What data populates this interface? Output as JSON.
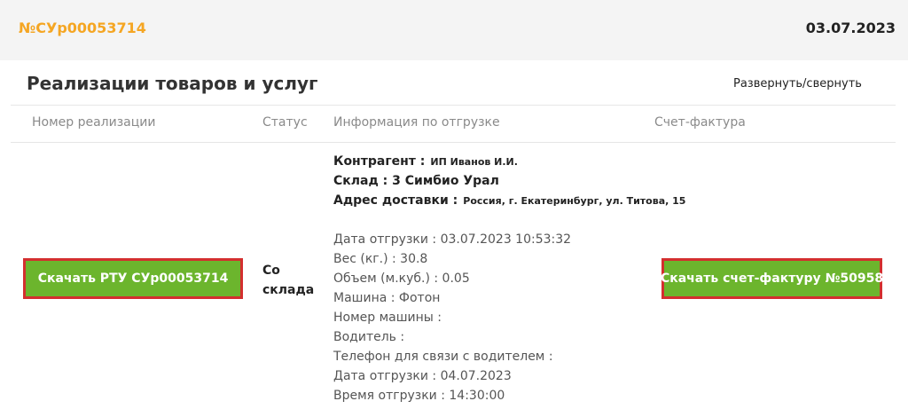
{
  "header": {
    "order_number": "№СУр00053714",
    "date": "03.07.2023"
  },
  "panel": {
    "title": "Реализации товаров и услуг",
    "toggle_label": "Развернуть/свернуть"
  },
  "columns": [
    "Номер реализации",
    "Статус",
    "Информация по отгрузке",
    "Счет-фактура"
  ],
  "row": {
    "download_rtu_label": "Скачать РТУ СУр00053714",
    "status_line1": "Со",
    "status_line2": "склада",
    "counterparty_label": "Контрагент :",
    "counterparty_value": "ИП Иванов И.И.",
    "warehouse": "Склад : 3 Симбио Урал",
    "address_label": "Адрес доставки :",
    "address_value": "Россия, г. Екатеринбург, ул. Титова, 15",
    "details": [
      "Дата отгрузки : 03.07.2023 10:53:32",
      "Вес (кг.) : 30.8",
      "Объем (м.куб.) : 0.05",
      "Машина : Фотон",
      "Номер машины :",
      "Водитель :",
      "Телефон для связи с водителем :",
      "Дата отгрузки : 04.07.2023",
      "Время отгрузки : 14:30:00"
    ],
    "download_invoice_label": "Скачать счет-фактуру №50958"
  },
  "colors": {
    "accent": "#f5a623",
    "button_green": "#6cb52d",
    "button_border": "#d32f2f"
  }
}
